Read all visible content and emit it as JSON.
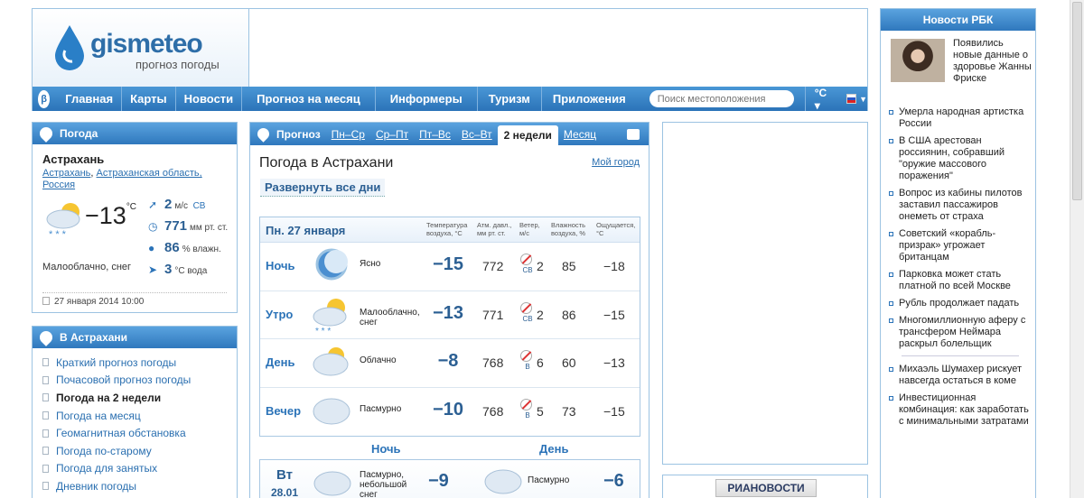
{
  "header": {
    "logo_brand": "gismeteo",
    "logo_sub": "прогноз погоды",
    "nav_beta": "β",
    "nav": [
      "Главная",
      "Карты",
      "Новости",
      "Прогноз на месяц",
      "Информеры",
      "Туризм",
      "Приложения"
    ],
    "search_placeholder": "Поиск местоположения",
    "unit": "°C ▾"
  },
  "current": {
    "title": "Погода",
    "city": "Астрахань",
    "region_links": [
      "Астрахань",
      "Астраханская область,",
      "Россия"
    ],
    "temp": "−13",
    "temp_unit": "°C",
    "condition": "Малооблачно, снег",
    "wind_value": "2",
    "wind_unit": "м/с",
    "wind_dir": "СВ",
    "pressure_value": "771",
    "pressure_unit": "мм рт. ст.",
    "humidity_value": "86",
    "humidity_unit": "% влажн.",
    "water_value": "3",
    "water_unit": "°C вода",
    "updated": "27 января 2014 10:00"
  },
  "links": {
    "title": "В Астрахани",
    "items": [
      "Краткий прогноз погоды",
      "Почасовой прогноз погоды",
      "Погода на 2 недели",
      "Погода на месяц",
      "Геомагнитная обстановка",
      "Погода по-старому",
      "Погода для занятых",
      "Дневник погоды"
    ],
    "current_index": 2
  },
  "forecast": {
    "tab_label": "Прогноз",
    "tabs": [
      "Пн–Ср",
      "Ср–Пт",
      "Пт–Вс",
      "Вс–Вт",
      "2 недели",
      "Месяц"
    ],
    "active_tab": "2 недели",
    "title": "Погода в Астрахани",
    "my_city": "Мой город",
    "expand": "Развернуть все дни",
    "day_header": "Пн. 27 января",
    "columns": [
      "Температура воздуха, °C",
      "Атм. давл., мм рт. ст.",
      "Ветер, м/с",
      "Влажность воздуха, %",
      "Ощущается, °C"
    ],
    "rows": [
      {
        "tod": "Ночь",
        "cond": "Ясно",
        "temp": "−15",
        "press": "772",
        "wdir": "СВ",
        "wspd": "2",
        "hum": "85",
        "feels": "−18"
      },
      {
        "tod": "Утро",
        "cond": "Малооблачно, снег",
        "temp": "−13",
        "press": "771",
        "wdir": "СВ",
        "wspd": "2",
        "hum": "86",
        "feels": "−15"
      },
      {
        "tod": "День",
        "cond": "Облачно",
        "temp": "−8",
        "press": "768",
        "wdir": "В",
        "wspd": "6",
        "hum": "60",
        "feels": "−13"
      },
      {
        "tod": "Вечер",
        "cond": "Пасмурно",
        "temp": "−10",
        "press": "768",
        "wdir": "В",
        "wspd": "5",
        "hum": "73",
        "feels": "−15"
      }
    ],
    "night_label": "Ночь",
    "day_label": "День",
    "next": {
      "dow": "Вт",
      "date": "28.01",
      "night_cond": "Пасмурно, небольшой снег",
      "night_temp": "−9",
      "day_cond": "Пасмурно",
      "day_temp": "−6"
    }
  },
  "ads": {
    "ria": "РИАНОВОСТИ"
  },
  "news": {
    "title": "Новости РБК",
    "top": "Появились новые данные о здоровье Жанны Фриске",
    "items": [
      "Умерла народная артистка России",
      "В США арестован россиянин, собравший \"оружие массового поражения\"",
      "Вопрос из кабины пилотов заставил пассажиров онеметь от страха",
      "Советский «корабль-призрак» угрожает британцам",
      "Парковка может стать платной по всей Москве",
      "Рубль продолжает падать",
      "Многомиллионную аферу с трансфером Неймара раскрыл болельщик"
    ],
    "items2": [
      "Михаэль Шумахер рискует навсегда остаться в коме",
      "Инвестиционная комбинация: как заработать с минимальными затратами"
    ]
  }
}
